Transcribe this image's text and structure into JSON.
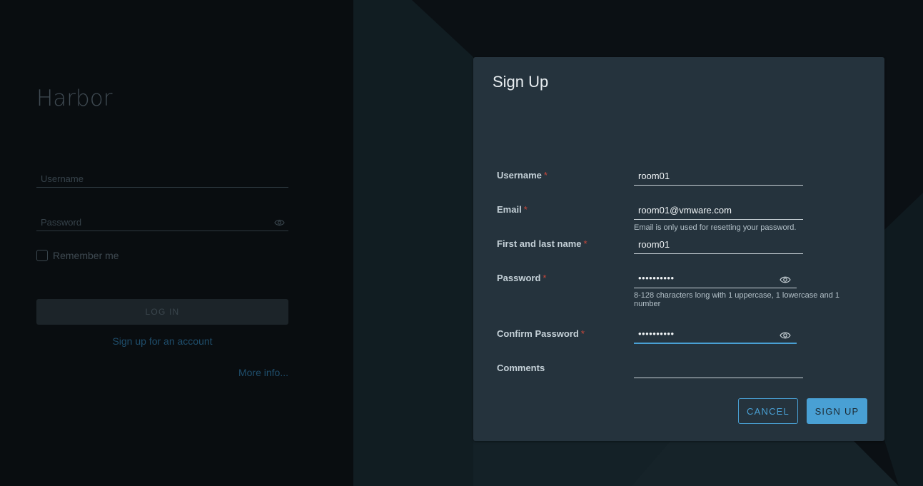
{
  "login": {
    "brand": "Harbor",
    "username_placeholder": "Username",
    "password_placeholder": "Password",
    "remember_label": "Remember me",
    "login_button": "LOG IN",
    "signup_link": "Sign up for an account",
    "more_info": "More info..."
  },
  "modal": {
    "title": "Sign Up",
    "fields": {
      "username": {
        "label": "Username",
        "value": "room01"
      },
      "email": {
        "label": "Email",
        "value": "room01@vmware.com",
        "helper": "Email is only used for resetting your password."
      },
      "fullname": {
        "label": "First and last name",
        "value": "room01"
      },
      "password": {
        "label": "Password",
        "value": "••••••••••",
        "helper": "8-128 characters long with 1 uppercase, 1 lowercase and 1 number"
      },
      "confirm": {
        "label": "Confirm Password",
        "value": "••••••••••"
      },
      "comments": {
        "label": "Comments",
        "value": ""
      }
    },
    "required_mark": "*",
    "cancel_button": "CANCEL",
    "signup_button": "SIGN UP"
  },
  "colors": {
    "accent": "#49a0d4",
    "modal_bg": "#25333d",
    "required": "#c9473a"
  }
}
